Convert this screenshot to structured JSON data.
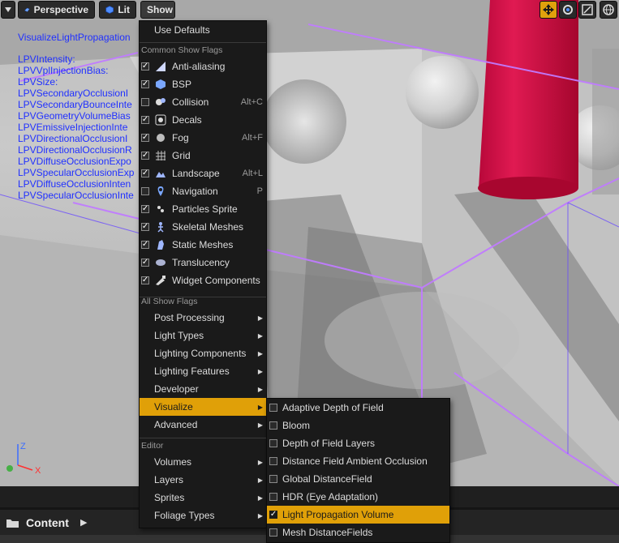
{
  "toolbar": {
    "perspective_label": "Perspective",
    "lit_label": "Lit",
    "show_label": "Show"
  },
  "overlay": {
    "title": "VisualizeLightPropagation",
    "lines": [
      "LPVIntensity:",
      "LPVVplInjectionBias:",
      "LPVSize:",
      "LPVSecondaryOcclusionI",
      "LPVSecondaryBounceInte",
      "LPVGeometryVolumeBias",
      "LPVEmissiveInjectionInte",
      "LPVDirectionalOcclusionI",
      "LPVDirectionalOcclusionR",
      "LPVDiffuseOcclusionExpo",
      "LPVSpecularOcclusionExp",
      "LPVDiffuseOcclusionInten",
      "LPVSpecularOcclusionInte"
    ]
  },
  "axis": {
    "z": "Z",
    "x": "X"
  },
  "show_menu": {
    "use_defaults": "Use Defaults",
    "common_header": "Common Show Flags",
    "common_flags": [
      {
        "label": "Anti-aliasing",
        "checked": true,
        "shortcut": "",
        "icon": "antialias-icon"
      },
      {
        "label": "BSP",
        "checked": true,
        "shortcut": "",
        "icon": "bsp-icon"
      },
      {
        "label": "Collision",
        "checked": false,
        "shortcut": "Alt+C",
        "icon": "collision-icon"
      },
      {
        "label": "Decals",
        "checked": true,
        "shortcut": "",
        "icon": "decals-icon"
      },
      {
        "label": "Fog",
        "checked": true,
        "shortcut": "Alt+F",
        "icon": "fog-icon"
      },
      {
        "label": "Grid",
        "checked": true,
        "shortcut": "",
        "icon": "grid-icon"
      },
      {
        "label": "Landscape",
        "checked": true,
        "shortcut": "Alt+L",
        "icon": "landscape-icon"
      },
      {
        "label": "Navigation",
        "checked": false,
        "shortcut": "P",
        "icon": "navigation-icon"
      },
      {
        "label": "Particles Sprite",
        "checked": true,
        "shortcut": "",
        "icon": "particles-icon"
      },
      {
        "label": "Skeletal Meshes",
        "checked": true,
        "shortcut": "",
        "icon": "skeletal-icon"
      },
      {
        "label": "Static Meshes",
        "checked": true,
        "shortcut": "",
        "icon": "static-mesh-icon"
      },
      {
        "label": "Translucency",
        "checked": true,
        "shortcut": "",
        "icon": "translucency-icon"
      },
      {
        "label": "Widget Components",
        "checked": true,
        "shortcut": "",
        "icon": "widget-icon"
      }
    ],
    "all_header": "All Show Flags",
    "all_items": [
      "Post Processing",
      "Light Types",
      "Lighting Components",
      "Lighting Features",
      "Developer",
      "Visualize",
      "Advanced"
    ],
    "editor_header": "Editor",
    "editor_items": [
      "Volumes",
      "Layers",
      "Sprites",
      "Foliage Types"
    ]
  },
  "visualize_menu": {
    "items": [
      {
        "label": "Adaptive Depth of Field",
        "checked": false
      },
      {
        "label": "Bloom",
        "checked": false
      },
      {
        "label": "Depth of Field Layers",
        "checked": false
      },
      {
        "label": "Distance Field Ambient Occlusion",
        "checked": false
      },
      {
        "label": "Global DistanceField",
        "checked": false
      },
      {
        "label": "HDR (Eye Adaptation)",
        "checked": false
      },
      {
        "label": "Light Propagation Volume",
        "checked": true
      },
      {
        "label": "Mesh DistanceFields",
        "checked": false
      }
    ]
  },
  "content_browser": {
    "tab_label": "Content"
  },
  "colors": {
    "accent": "#e0a008",
    "overlay_text": "#2030ff",
    "cylinder": "#d8124a",
    "lpv_lines": "#c07bff"
  }
}
